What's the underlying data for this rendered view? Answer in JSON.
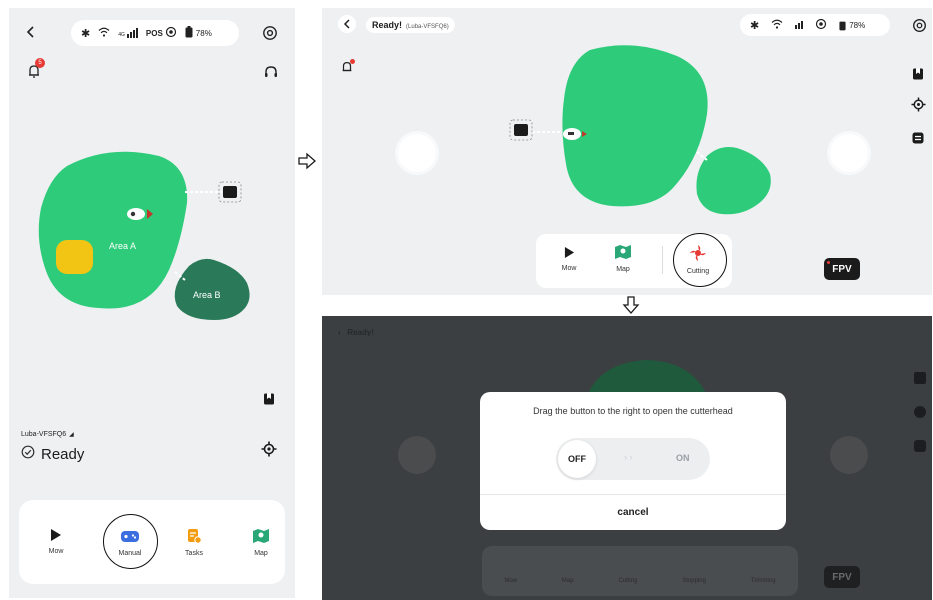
{
  "left_screen": {
    "status": {
      "bluetooth": "bluetooth-icon",
      "wifi": "wifi-icon",
      "signal": "4G",
      "pos_label": "POS",
      "battery": "78%"
    },
    "notification_badge": "5",
    "map": {
      "area_a_label": "Area A",
      "area_b_label": "Area B"
    },
    "device_name": "Luba-VFSFQ6",
    "status_text": "Ready",
    "bottom_nav": [
      {
        "label": "Mow",
        "icon": "play-icon"
      },
      {
        "label": "Manual",
        "icon": "gamepad-icon"
      },
      {
        "label": "Tasks",
        "icon": "tasks-icon"
      },
      {
        "label": "Map",
        "icon": "map-icon"
      }
    ]
  },
  "top_right_screen": {
    "status_title": "Ready!",
    "device_name": "(Luba-VFSFQ6)",
    "battery": "78%",
    "toolbar": [
      {
        "label": "Mow",
        "icon": "play-icon"
      },
      {
        "label": "Map",
        "icon": "map-icon"
      },
      {
        "label": "Cutting",
        "icon": "cutting-blade-icon"
      }
    ],
    "fpv_label": "FPV"
  },
  "bottom_right_screen": {
    "dialog_message": "Drag the button to the right to open the cutterhead",
    "toggle_off": "OFF",
    "toggle_on": "ON",
    "cancel_label": "cancel",
    "fpv_label": "FPV",
    "toolbar": [
      {
        "label": "Mow"
      },
      {
        "label": "Map"
      },
      {
        "label": "Cutting"
      },
      {
        "label": "Stopping"
      },
      {
        "label": "Trimming"
      }
    ]
  },
  "colors": {
    "area_green": "#2ecc7a",
    "area_dark": "#2a7a5a",
    "yellow_zone": "#f2c414",
    "accent_blue": "#3b6fe0",
    "cutting_red": "#e53a35"
  }
}
